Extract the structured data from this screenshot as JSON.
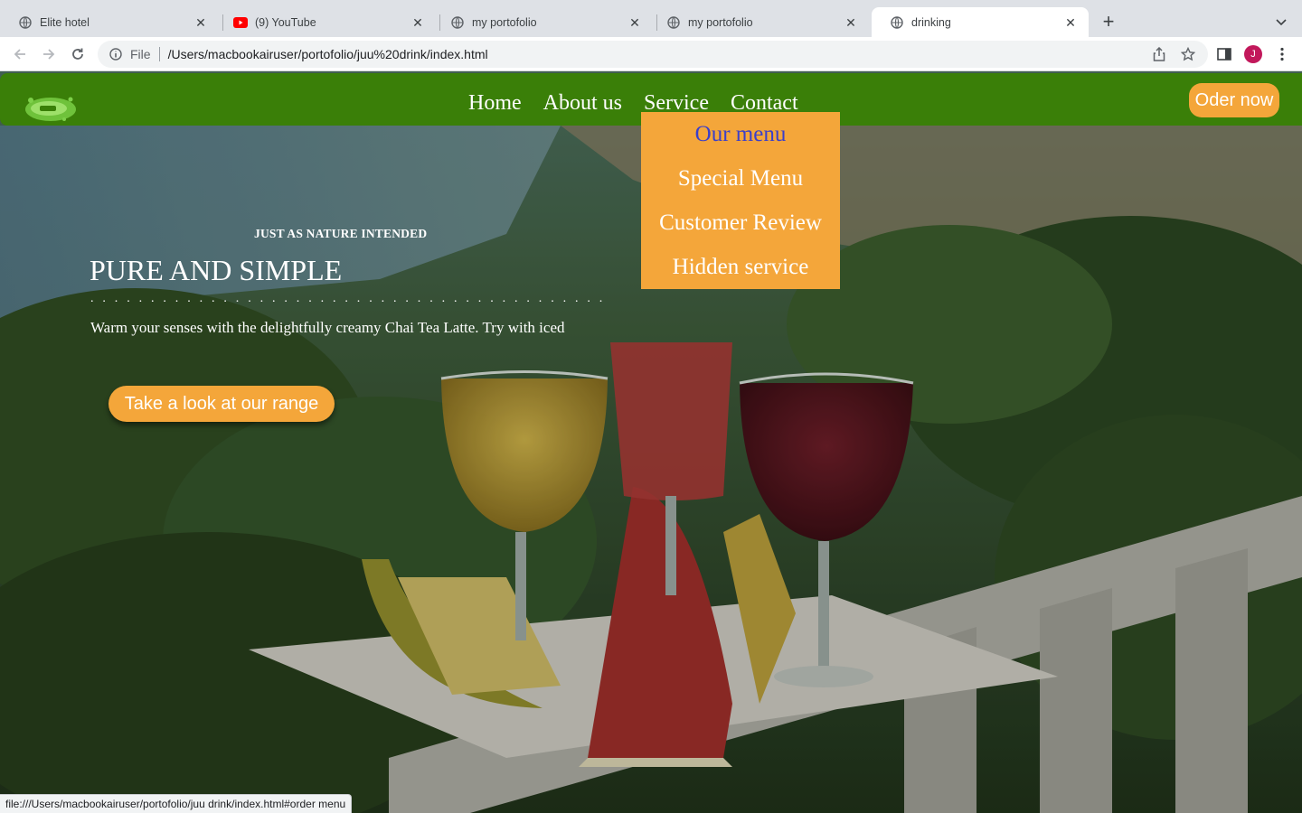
{
  "browser": {
    "tabs": [
      {
        "title": "Elite hotel",
        "favicon": "globe-icon",
        "active": false
      },
      {
        "title": "(9) YouTube",
        "favicon": "youtube-icon",
        "active": false
      },
      {
        "title": "my portofolio",
        "favicon": "globe-icon",
        "active": false
      },
      {
        "title": "my portofolio",
        "favicon": "globe-icon",
        "active": false
      },
      {
        "title": "drinking",
        "favicon": "globe-icon",
        "active": true
      }
    ],
    "address": {
      "scheme": "File",
      "url": "/Users/macbookairuser/portofolio/juu%20drink/index.html"
    },
    "profile_initial": "J",
    "status_url": "file:///Users/macbookairuser/portofolio/juu drink/index.html#order menu"
  },
  "site": {
    "nav": {
      "links": [
        "Home",
        "About us",
        "Service",
        "Contact"
      ],
      "order_button": "Oder now"
    },
    "service_dropdown": {
      "items": [
        "Our menu",
        "Special Menu",
        "Customer Review",
        "Hidden service"
      ],
      "hovered_item": "Our menu"
    },
    "hero": {
      "eyebrow": "JUST AS NATURE INTENDED",
      "headline": "PURE AND SIMPLE",
      "divider": ". . . . . . . . . . . . . . . . . . . . . . . . . . . . . . . . . . . . . . . . . . .",
      "lead": "Warm your senses with the delightfully creamy Chai Tea Latte. Try with iced",
      "cta": "Take a look at our range"
    }
  },
  "colors": {
    "nav_green": "#3a7f08",
    "accent_orange": "#f4a63a",
    "dropdown_hover_text": "#3b3fc9"
  }
}
